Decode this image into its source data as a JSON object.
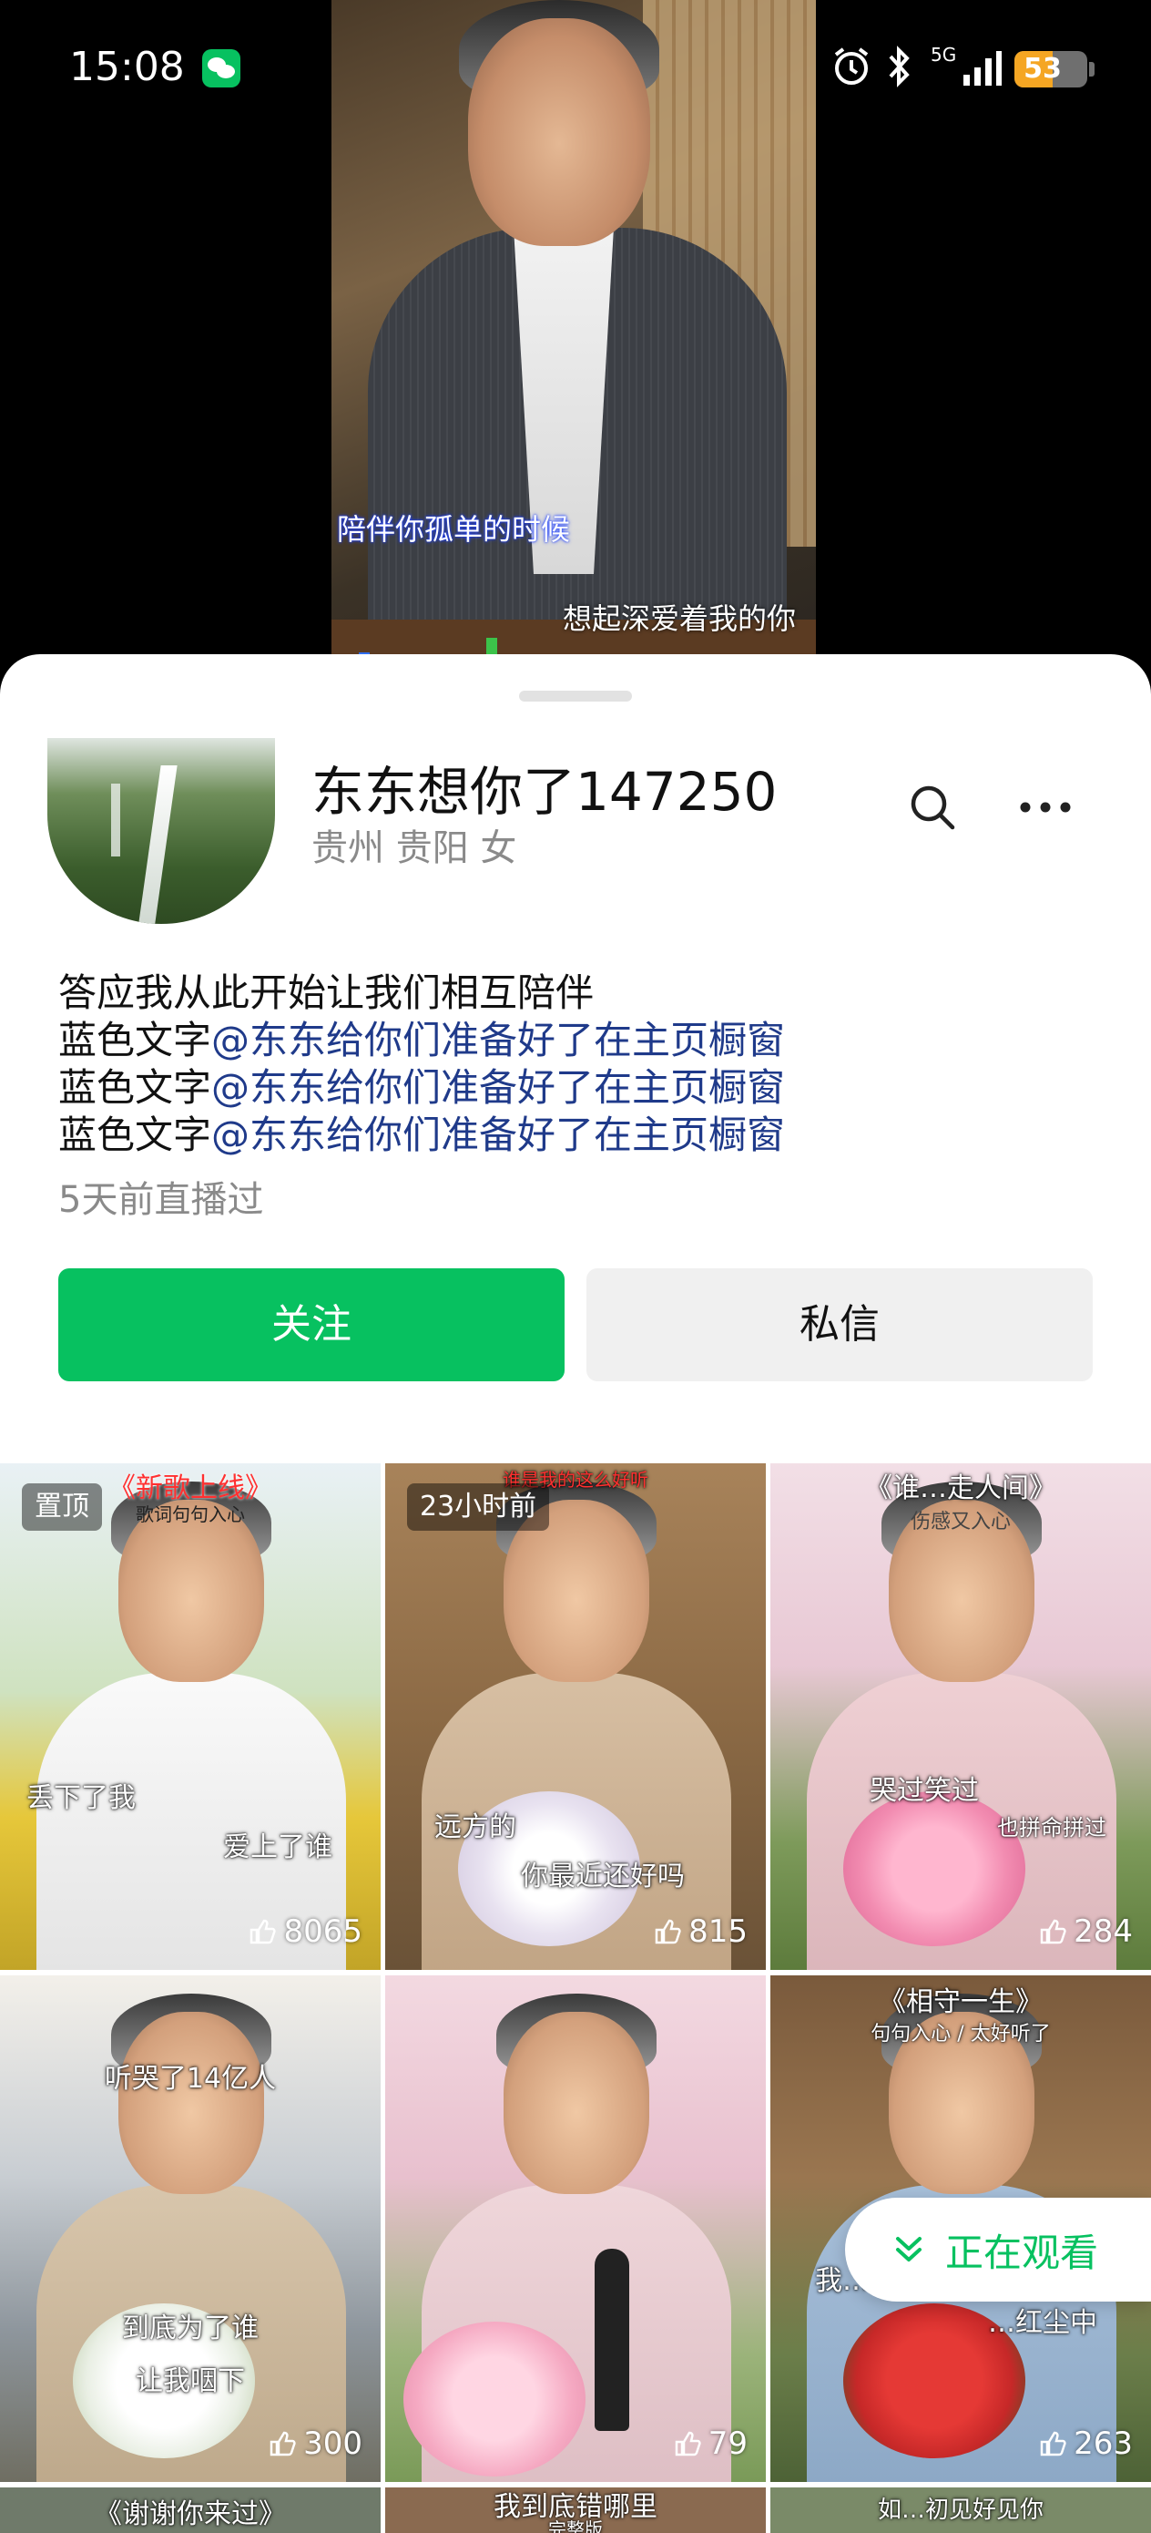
{
  "status_bar": {
    "time": "15:08",
    "network": "5G",
    "battery": "53",
    "battery_level": 0.53
  },
  "video": {
    "subtitle_1": "陪伴你孤单的时候",
    "subtitle_2": "想起深爱着我的你"
  },
  "profile": {
    "name": "东东想你了147250",
    "location": "贵州 贵阳 女",
    "bio_line_1": "答应我从此开始让我们相互陪伴",
    "bio_prefix": "蓝色文字",
    "bio_link": "@东东给你们准备好了在主页橱窗",
    "last_live": "5天前直播过"
  },
  "actions": {
    "follow": "关注",
    "message": "私信"
  },
  "videos": [
    {
      "tag": "置顶",
      "title": "《新歌上线》",
      "subtitle": "歌词句句入心",
      "caption_1": "丢下了我",
      "caption_2": "爱上了谁",
      "likes": "8065"
    },
    {
      "tag": "23小时前",
      "title": "谁是我的这么好听",
      "subtitle": "",
      "caption_1": "远方的",
      "caption_2": "你最近还好吗",
      "likes": "815"
    },
    {
      "tag": "",
      "title": "《谁…走人间》",
      "subtitle": "伤感又入心",
      "caption_1": "哭过笑过",
      "caption_2": "也拼命拼过",
      "likes": "284"
    },
    {
      "tag": "",
      "title": "听哭了14亿人",
      "subtitle": "",
      "caption_1": "到底为了谁",
      "caption_2": "让我咽下",
      "likes": "300"
    },
    {
      "tag": "",
      "title": "",
      "subtitle": "",
      "caption_1": "",
      "caption_2": "",
      "likes": "79"
    },
    {
      "tag": "",
      "title": "《相守一生》",
      "subtitle": "句句入心 / 太好听了",
      "caption_1": "我…",
      "caption_2": "…红尘中",
      "likes": "263"
    }
  ],
  "bottom_row": {
    "left": "《谢谢你来过》",
    "middle": "我到底错哪里",
    "middle_sub": "完整版",
    "right": "如…初见好见你"
  },
  "watching_button": "正在观看",
  "colors": {
    "accent": "#07c160",
    "link": "#1f3a8a"
  }
}
